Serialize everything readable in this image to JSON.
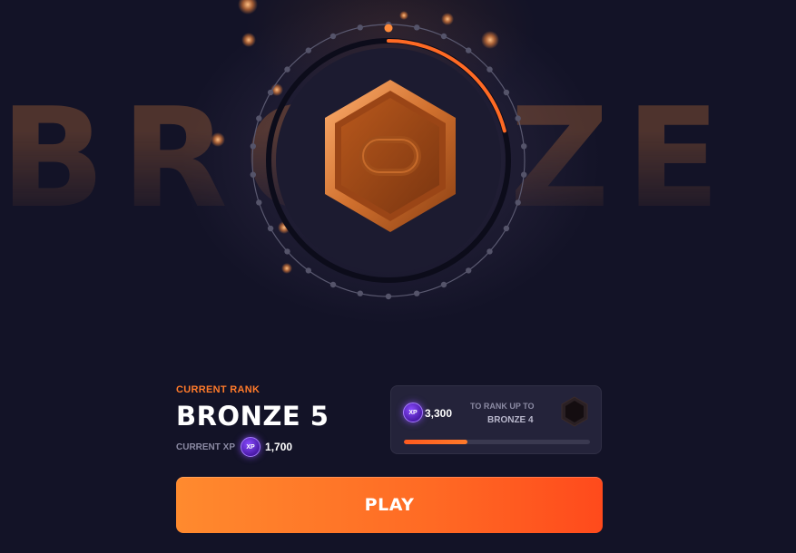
{
  "background_title": "BRONZE 5",
  "rank": {
    "current_label": "CURRENT RANK",
    "name": "BRONZE 5",
    "xp_label": "CURRENT XP",
    "xp_value": "1,700",
    "progress_ring_fraction": 0.21
  },
  "rank_up": {
    "xp_needed": "3,300",
    "line1": "TO RANK UP TO",
    "next_rank": "BRONZE 4",
    "progress_fraction": 0.34
  },
  "xp_badge_text": "XP",
  "play_label": "PLAY",
  "colors": {
    "accent": "#ff7a2a",
    "background": "#131327",
    "bronze": "#c8682e",
    "xp_purple": "#7a3cff"
  },
  "icons": [
    "bronze-hexagon-emblem",
    "xp-badge-icon",
    "next-rank-emblem-icon"
  ]
}
